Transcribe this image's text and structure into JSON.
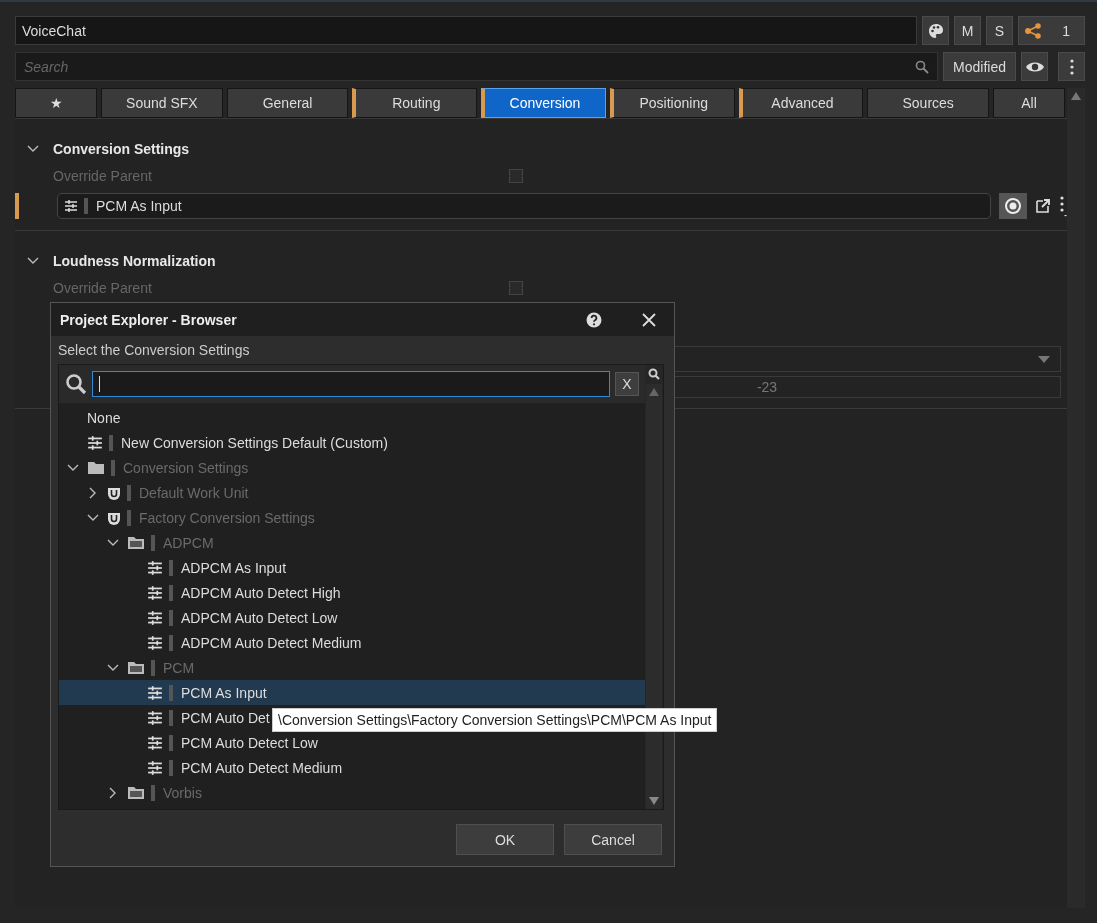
{
  "header": {
    "name": "VoiceChat",
    "mute": "M",
    "solo": "S",
    "share_count": "1"
  },
  "search": {
    "placeholder": "Search"
  },
  "filter_button": "Modified",
  "tabs": [
    {
      "label": "★",
      "selected": false,
      "modified": false
    },
    {
      "label": "Sound SFX",
      "selected": false,
      "modified": false
    },
    {
      "label": "General",
      "selected": false,
      "modified": false
    },
    {
      "label": "Routing",
      "selected": false,
      "modified": true
    },
    {
      "label": "Conversion",
      "selected": true,
      "modified": true
    },
    {
      "label": "Positioning",
      "selected": false,
      "modified": true
    },
    {
      "label": "Advanced",
      "selected": false,
      "modified": true
    },
    {
      "label": "Sources",
      "selected": false,
      "modified": false
    },
    {
      "label": "All",
      "selected": false,
      "modified": false
    }
  ],
  "sections": [
    {
      "title": "Conversion Settings",
      "expanded": true,
      "override_label": "Override Parent",
      "override_checked": false,
      "value": "PCM As Input"
    },
    {
      "title": "Loudness Normalization",
      "expanded": true,
      "override_label": "Override Parent",
      "override_checked": false,
      "number": "-23"
    }
  ],
  "dialog": {
    "title": "Project Explorer - Browser",
    "prompt": "Select the Conversion Settings",
    "clear_label": "X",
    "tree": [
      {
        "kind": "none",
        "label": "None",
        "selected": false
      },
      {
        "kind": "item",
        "label": "New Conversion Settings Default (Custom)",
        "selected": false
      },
      {
        "kind": "folder",
        "label": "Conversion Settings",
        "selected": false,
        "expanded": true,
        "children": [
          {
            "kind": "workunit",
            "label": "Default Work Unit",
            "selected": false,
            "expanded": false
          },
          {
            "kind": "workunit",
            "label": "Factory Conversion Settings",
            "selected": false,
            "expanded": true,
            "children": [
              {
                "kind": "folder",
                "label": "ADPCM",
                "selected": false,
                "expanded": true,
                "children": [
                  {
                    "kind": "item",
                    "label": "ADPCM As Input",
                    "selected": false
                  },
                  {
                    "kind": "item",
                    "label": "ADPCM Auto Detect High",
                    "selected": false
                  },
                  {
                    "kind": "item",
                    "label": "ADPCM Auto Detect Low",
                    "selected": false
                  },
                  {
                    "kind": "item",
                    "label": "ADPCM Auto Detect Medium",
                    "selected": false
                  }
                ]
              },
              {
                "kind": "folder",
                "label": "PCM",
                "selected": false,
                "expanded": true,
                "children": [
                  {
                    "kind": "item",
                    "label": "PCM As Input",
                    "selected": true
                  },
                  {
                    "kind": "item",
                    "label": "PCM Auto Det",
                    "selected": false
                  },
                  {
                    "kind": "item",
                    "label": "PCM Auto Detect Low",
                    "selected": false
                  },
                  {
                    "kind": "item",
                    "label": "PCM Auto Detect Medium",
                    "selected": false
                  }
                ]
              },
              {
                "kind": "folder",
                "label": "Vorbis",
                "selected": false,
                "expanded": false
              }
            ]
          }
        ]
      }
    ],
    "tooltip": "\\Conversion Settings\\Factory Conversion Settings\\PCM\\PCM As Input",
    "buttons": [
      "OK",
      "Cancel"
    ]
  }
}
